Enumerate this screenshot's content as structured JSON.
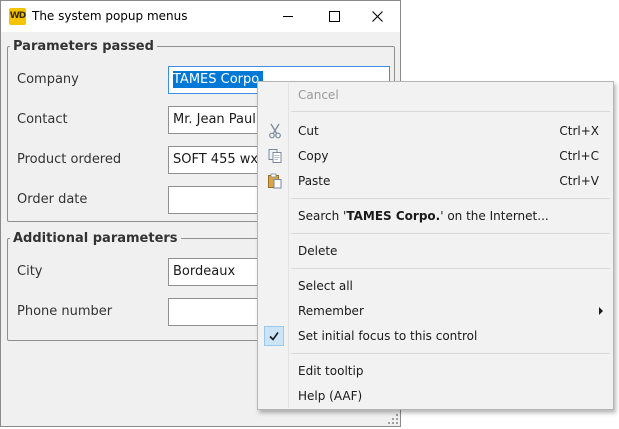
{
  "window": {
    "title": "The system popup menus",
    "app_icon_text": "WD",
    "app_icon_color": "#f5c400"
  },
  "groups": {
    "parameters": {
      "legend": "Parameters passed",
      "company_label": "Company",
      "company_value": "TAMES Corpo.",
      "contact_label": "Contact",
      "contact_value": "Mr. Jean Paul L",
      "product_label": "Product ordered",
      "product_value": "SOFT 455 wx",
      "date_label": "Order date",
      "date_value": ""
    },
    "additional": {
      "legend": "Additional parameters",
      "city_label": "City",
      "city_value": "Bordeaux",
      "phone_label": "Phone number",
      "phone_value": ""
    }
  },
  "context_menu": {
    "cancel": "Cancel",
    "cut": "Cut",
    "cut_shortcut": "Ctrl+X",
    "copy": "Copy",
    "copy_shortcut": "Ctrl+C",
    "paste": "Paste",
    "paste_shortcut": "Ctrl+V",
    "search_prefix": "Search '",
    "search_term": "TAMES Corpo.",
    "search_suffix": "' on the Internet...",
    "delete": "Delete",
    "select_all": "Select all",
    "remember": "Remember",
    "set_focus": "Set initial focus to this control",
    "set_focus_checked": true,
    "edit_tooltip": "Edit tooltip",
    "help": "Help (AAF)"
  },
  "colors": {
    "selection": "#0078d7",
    "focus_border": "#3d8ee0",
    "menu_background": "#f2f2f2",
    "check_highlight": "#cce4f7"
  },
  "icons": {
    "cut": "scissors-icon",
    "copy": "copy-icon",
    "paste": "paste-icon",
    "check": "checkmark-icon",
    "submenu": "chevron-right-icon"
  }
}
